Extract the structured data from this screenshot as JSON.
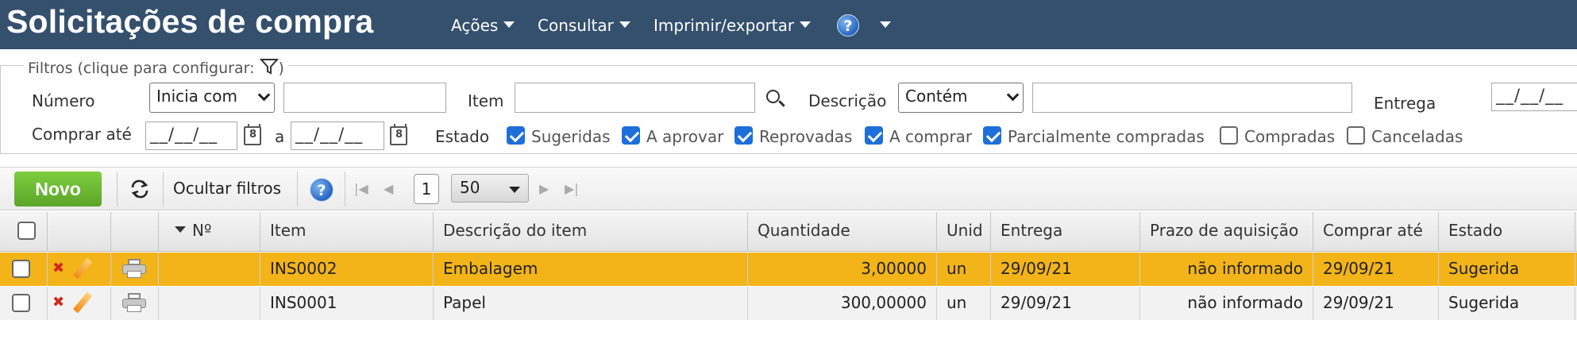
{
  "header": {
    "title": "Solicitações de compra",
    "menu": [
      {
        "label": "Ações"
      },
      {
        "label": "Consultar"
      },
      {
        "label": "Imprimir/exportar"
      }
    ]
  },
  "filters": {
    "legend": "Filtros (clique para configurar:",
    "legend_close": ")",
    "numero_label": "Número",
    "numero_mode": "Inicia com",
    "numero_value": "",
    "item_label": "Item",
    "item_value": "",
    "descricao_label": "Descrição",
    "descricao_mode": "Contém",
    "descricao_value": "",
    "entrega_label": "Entrega",
    "entrega_value": "__/__/__",
    "comprar_ate_label": "Comprar até",
    "comprar_ate_from": "__/__/__",
    "range_sep": "a",
    "comprar_ate_to": "__/__/__",
    "estado_label": "Estado",
    "estados": [
      {
        "label": "Sugeridas",
        "checked": true
      },
      {
        "label": "A aprovar",
        "checked": true
      },
      {
        "label": "Reprovadas",
        "checked": true
      },
      {
        "label": "A comprar",
        "checked": true
      },
      {
        "label": "Parcialmente compradas",
        "checked": true
      },
      {
        "label": "Compradas",
        "checked": false
      },
      {
        "label": "Canceladas",
        "checked": false
      }
    ]
  },
  "toolbar": {
    "new_label": "Novo",
    "hide_filters_label": "Ocultar filtros",
    "page": "1",
    "page_size": "50"
  },
  "grid": {
    "columns": [
      "Nº",
      "Item",
      "Descrição do item",
      "Quantidade",
      "Unid",
      "Entrega",
      "Prazo de aquisição",
      "Comprar até",
      "Estado"
    ],
    "rows": [
      {
        "numero": "",
        "item": "INS0002",
        "descricao": "Embalagem",
        "quantidade": "3,00000",
        "unid": "un",
        "entrega": "29/09/21",
        "prazo": "não informado",
        "comprar_ate": "29/09/21",
        "estado": "Sugerida",
        "selected": true
      },
      {
        "numero": "",
        "item": "INS0001",
        "descricao": "Papel",
        "quantidade": "300,00000",
        "unid": "un",
        "entrega": "29/09/21",
        "prazo": "não informado",
        "comprar_ate": "29/09/21",
        "estado": "Sugerida",
        "selected": false
      }
    ]
  },
  "colors": {
    "header_bg": "#34506d",
    "selected_row": "#f3b41a",
    "new_button": "#6ab833",
    "checkbox_checked": "#1e6fd9"
  }
}
